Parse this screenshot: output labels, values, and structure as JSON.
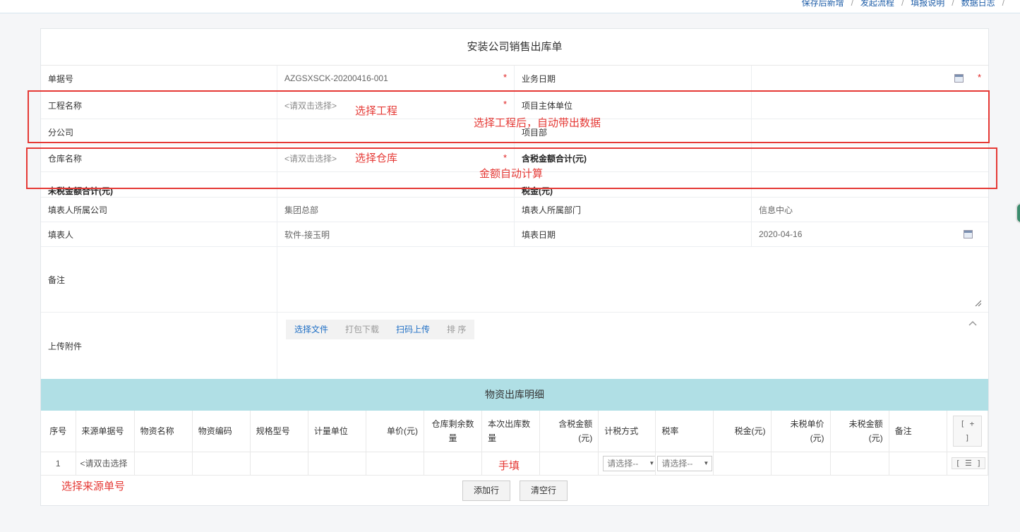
{
  "toplinks": [
    "保存后新增",
    "发起流程",
    "填报说明",
    "数据日志"
  ],
  "form": {
    "title": "安装公司销售出库单",
    "doc_no_label": "单据号",
    "doc_no_value": "AZGSXSCK-20200416-001",
    "biz_date_label": "业务日期",
    "biz_date_value": "",
    "project_label": "工程名称",
    "project_placeholder": "<请双击选择>",
    "owner_label": "项目主体单位",
    "branch_label": "分公司",
    "dept_label": "项目部",
    "warehouse_label": "仓库名称",
    "warehouse_placeholder": "<请双击选择>",
    "taxed_total_label": "含税金额合计(元)",
    "untaxed_total_label": "未税金额合计(元)",
    "tax_label": "税金(元)",
    "filler_company_label": "填表人所属公司",
    "filler_company_value": "集团总部",
    "filler_dept_label": "填表人所属部门",
    "filler_dept_value": "信息中心",
    "filler_label": "填表人",
    "filler_value": "软件-接玉明",
    "fill_date_label": "填表日期",
    "fill_date_value": "2020-04-16",
    "remark_label": "备注",
    "remark_value": "",
    "attach_label": "上传附件",
    "attach_buttons": [
      "选择文件",
      "打包下载",
      "扫码上传",
      "排 序"
    ]
  },
  "detail": {
    "title": "物资出库明细",
    "columns": [
      "序号",
      "来源单据号",
      "物资名称",
      "物资编码",
      "规格型号",
      "计量单位",
      "单价(元)",
      "仓库剩余数量",
      "本次出库数量",
      "含税金额(元)",
      "计税方式",
      "税率",
      "税金(元)",
      "未税单价(元)",
      "未税金额(元)",
      "备注",
      "[ + ]"
    ],
    "rows": [
      {
        "no": "1",
        "source": "<请双击选择",
        "tax_method": "请选择--",
        "tax_rate": "请选择--",
        "action": "[ ☰ ]"
      }
    ],
    "add_row": "添加行",
    "clear_rows": "清空行"
  },
  "annotations": {
    "select_project": "选择工程",
    "auto_fill": "选择工程后，自动带出数据",
    "select_warehouse": "选择仓库",
    "auto_calc": "金额自动计算",
    "manual_fill": "手填",
    "select_source": "选择来源单号"
  },
  "colors": {
    "accent": "#e53935",
    "header_bg": "#b0dfe5",
    "link": "#1f6fc5"
  }
}
